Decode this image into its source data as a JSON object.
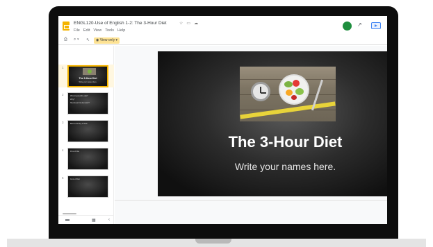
{
  "doc": {
    "title": "ENGL120-Use of English 1-2: The 3-Hour Diet",
    "title_icons": [
      "star-icon",
      "folder-icon",
      "cloud-icon"
    ]
  },
  "menu": [
    "File",
    "Edit",
    "View",
    "Tools",
    "Help"
  ],
  "toolbar": {
    "view_only_label": "View only",
    "icons": [
      "print-icon",
      "zoom-icon",
      "cursor-icon"
    ]
  },
  "header": {
    "avatar_letter": "",
    "trend_icon": "trending-icon",
    "present_icon": "present-icon"
  },
  "slides": [
    {
      "num": "1",
      "title": "The 3-Hour Diet",
      "subtitle": "Write your names here.",
      "active": true
    },
    {
      "num": "2",
      "lines": [
        "Who invented the diet?",
        "Why?",
        "How does this diet work?"
      ]
    },
    {
      "num": "3",
      "lines": [
        "Brief summary of Rule"
      ]
    },
    {
      "num": "4",
      "lines": [
        "Pros of Diet"
      ]
    },
    {
      "num": "5",
      "lines": [
        "Cons of Diet"
      ]
    }
  ],
  "main_slide": {
    "title": "The 3-Hour Diet",
    "subtitle": "Write your names here."
  },
  "colors": {
    "logo": "#f4b400",
    "avatar": "#1e8e3e",
    "view_only_bg": "#fde293",
    "present": "#4285f4"
  }
}
